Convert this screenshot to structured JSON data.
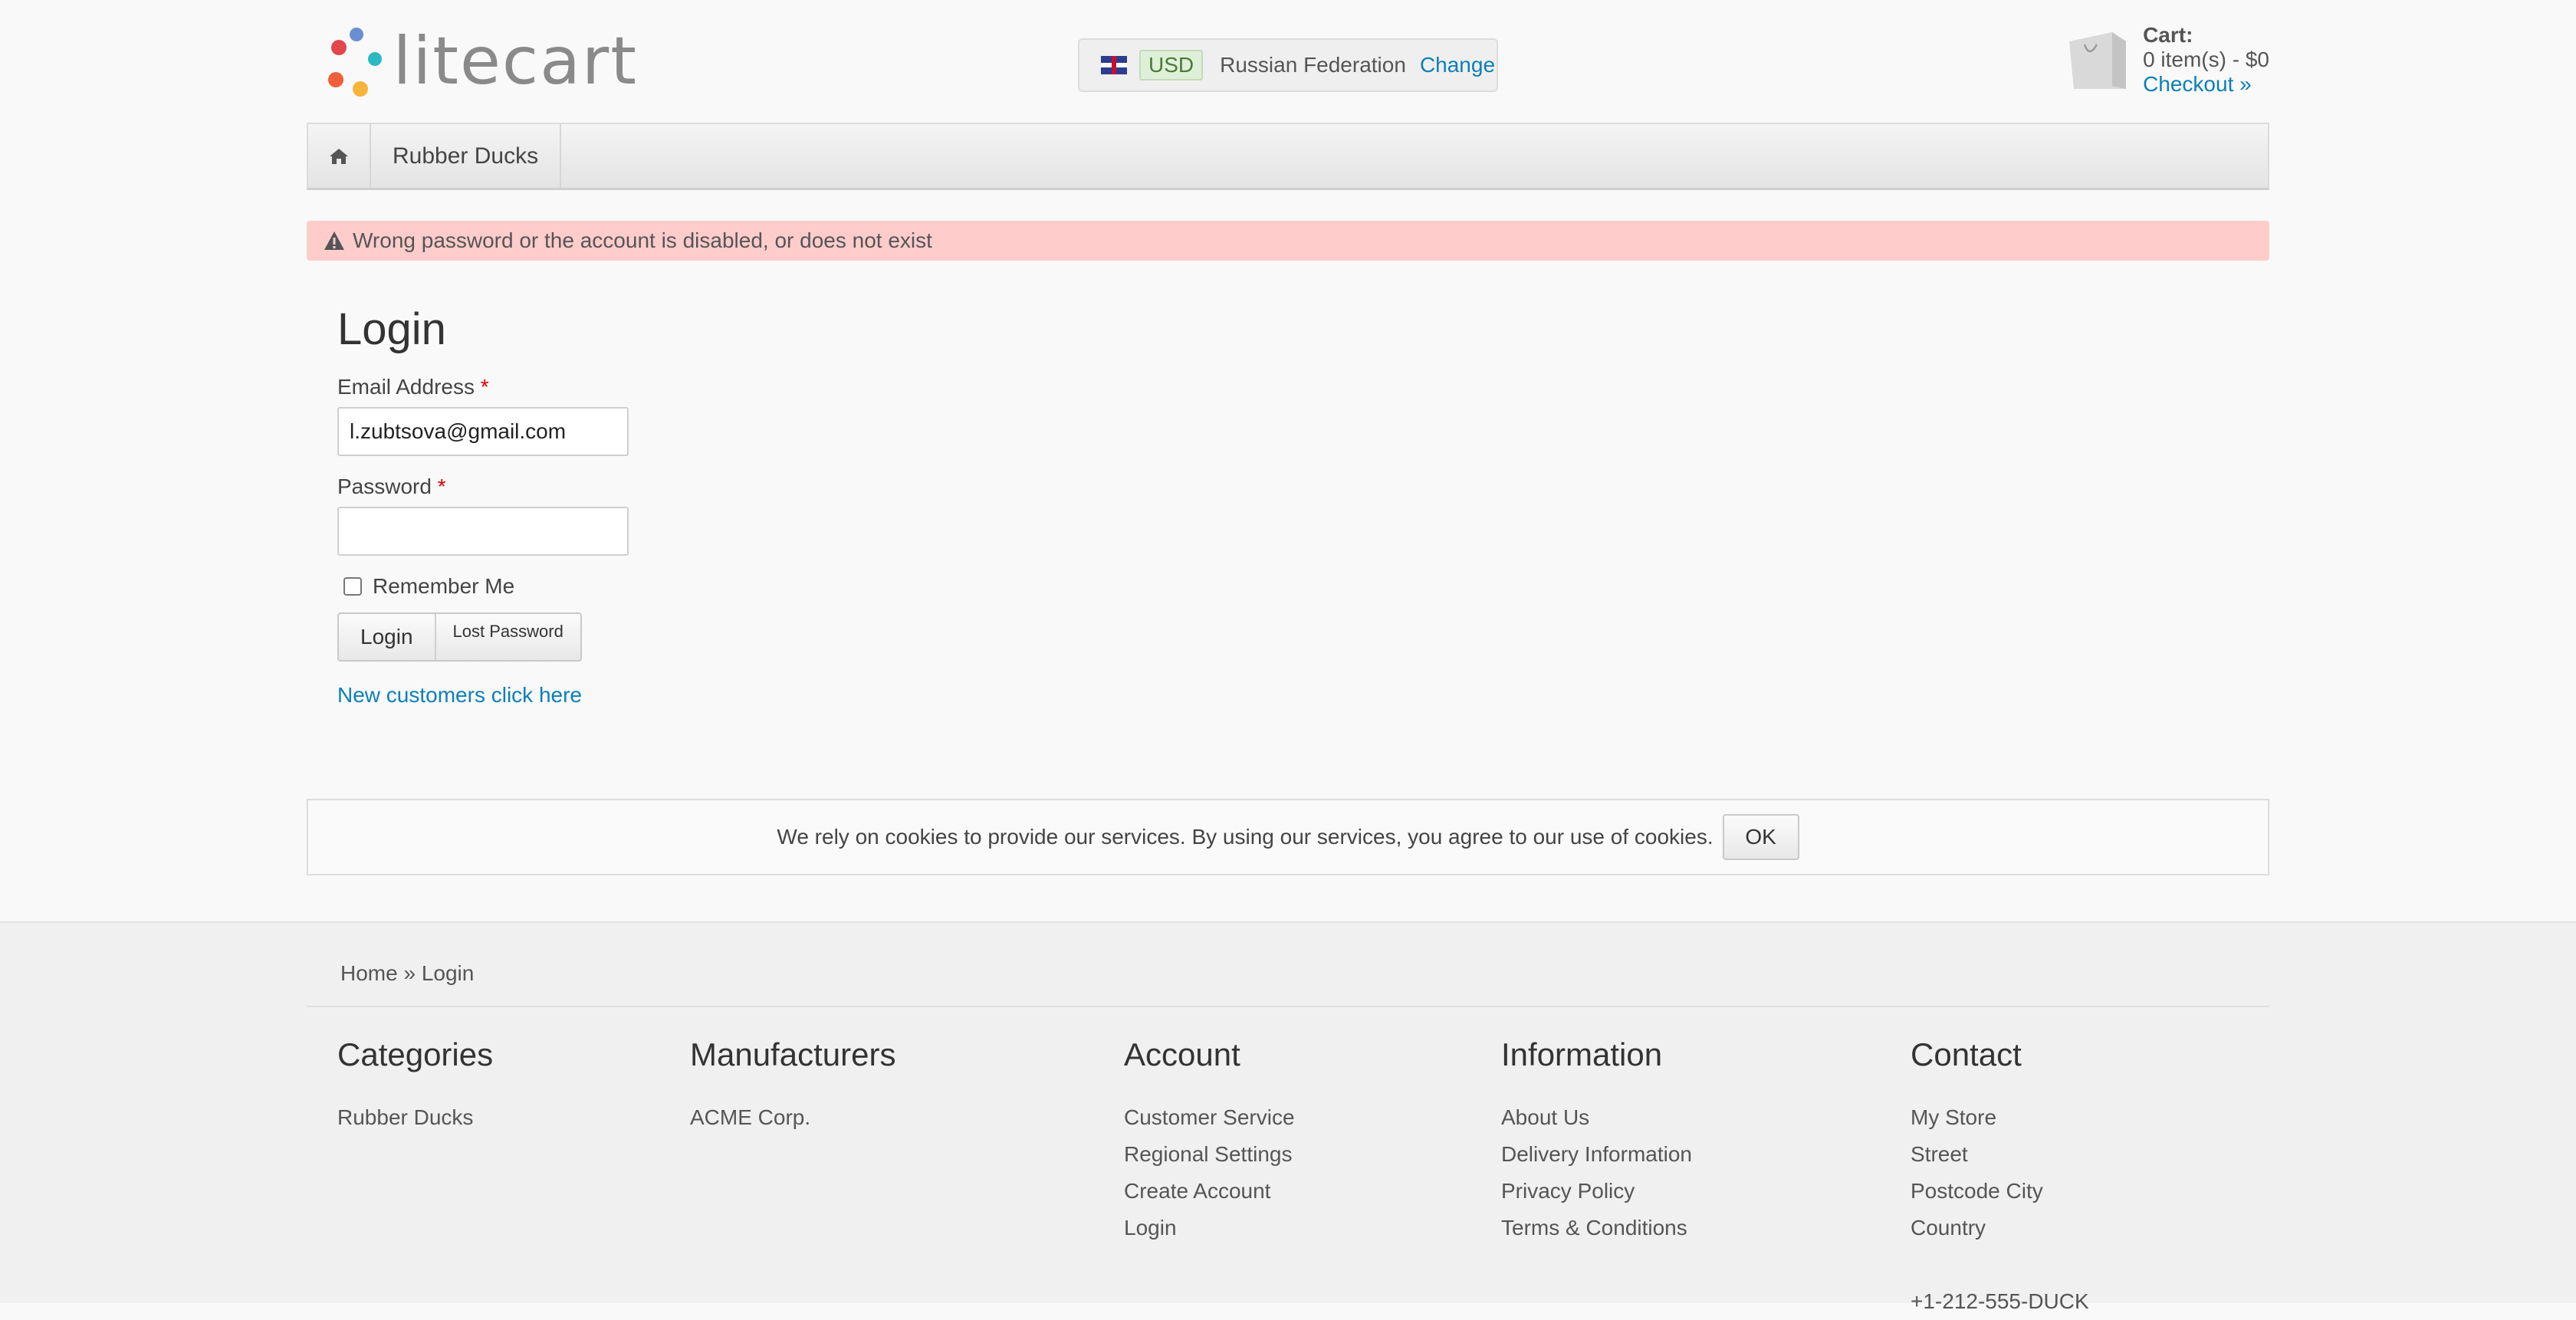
{
  "header": {
    "logo_text": "litecart",
    "region": {
      "currency": "USD",
      "country": "Russian Federation",
      "change_label": "Change"
    },
    "cart": {
      "title": "Cart:",
      "summary": "0 item(s) - $0",
      "checkout_label": "Checkout »"
    }
  },
  "nav": {
    "items": [
      {
        "label": "Rubber Ducks"
      }
    ]
  },
  "alert": {
    "message": "Wrong password or the account is disabled, or does not exist"
  },
  "login": {
    "title": "Login",
    "email_label": "Email Address",
    "email_value": "l.zubtsova@gmail.com",
    "password_label": "Password",
    "password_value": "",
    "required_mark": "*",
    "remember_label": "Remember Me",
    "login_button": "Login",
    "lost_password_button": "Lost Password",
    "new_customers_link": "New customers click here"
  },
  "cookie": {
    "message": "We rely on cookies to provide our services. By using our services, you agree to our use of cookies.",
    "ok_label": "OK"
  },
  "footer": {
    "breadcrumb": {
      "home": "Home",
      "separator": "»",
      "current": "Login"
    },
    "columns": [
      {
        "title": "Categories",
        "items": [
          "Rubber Ducks"
        ]
      },
      {
        "title": "Manufacturers",
        "items": [
          "ACME Corp."
        ]
      },
      {
        "title": "Account",
        "items": [
          "Customer Service",
          "Regional Settings",
          "Create Account",
          "Login"
        ]
      },
      {
        "title": "Information",
        "items": [
          "About Us",
          "Delivery Information",
          "Privacy Policy",
          "Terms & Conditions"
        ]
      },
      {
        "title": "Contact",
        "items": [
          "My Store",
          "Street",
          "Postcode City",
          "Country",
          "",
          "+1-212-555-DUCK"
        ]
      }
    ]
  },
  "colors": {
    "link": "#0d7fb8",
    "alert_bg": "#ffcccc",
    "required": "#dd0000"
  }
}
